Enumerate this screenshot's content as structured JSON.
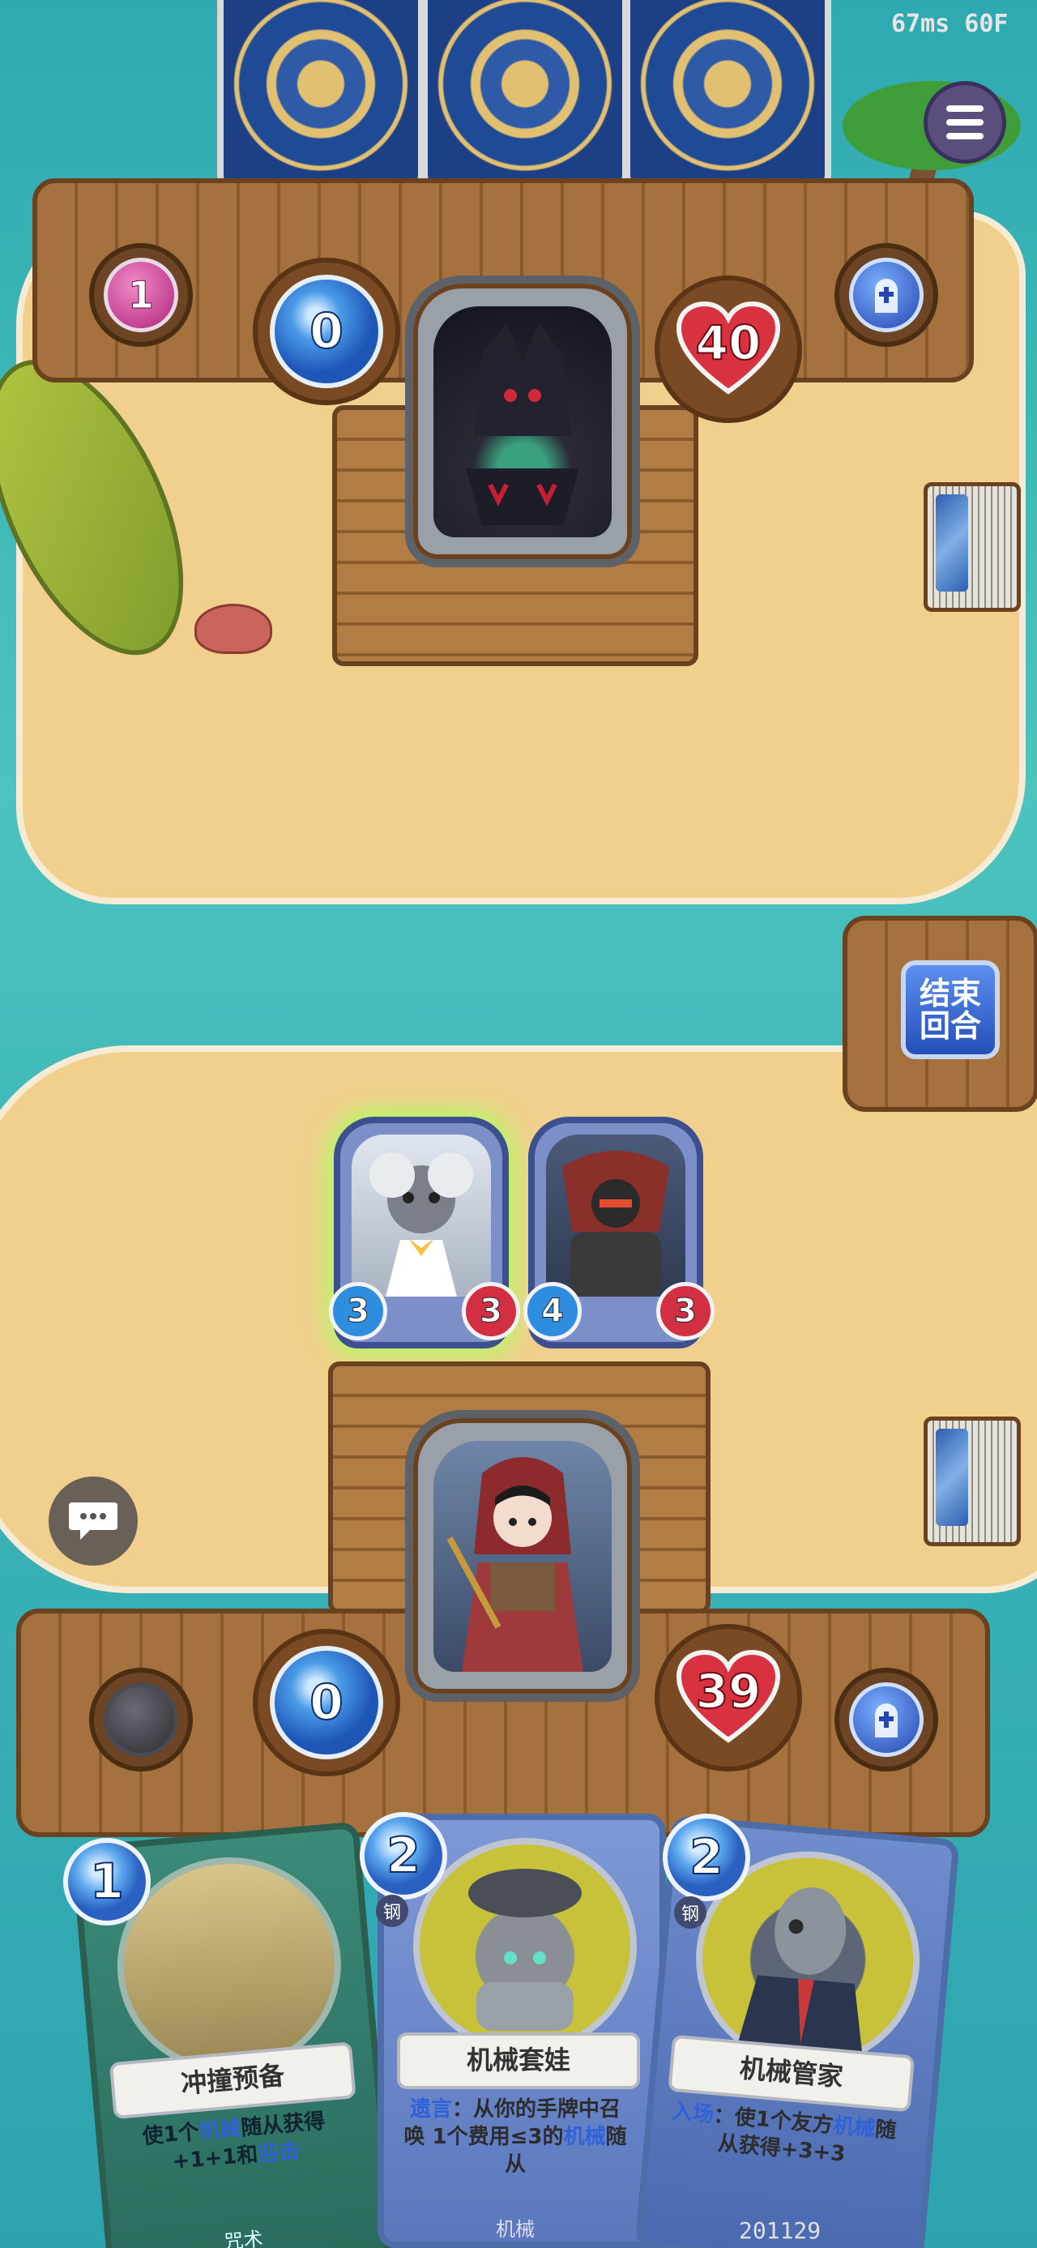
{
  "hud": {
    "perf": "67ms 60F",
    "uid": "201129"
  },
  "opponent": {
    "crystal": "1",
    "mana": "0",
    "health": "40"
  },
  "player": {
    "mana": "0",
    "health": "39"
  },
  "board": {
    "player_minions": [
      {
        "attack": "3",
        "health": "3",
        "playable": true
      },
      {
        "attack": "4",
        "health": "3",
        "playable": false
      }
    ]
  },
  "buttons": {
    "end_turn": "结束回合"
  },
  "hand": [
    {
      "cost": "1",
      "name": "冲撞预备",
      "desc_pre": "使1个",
      "desc_kw": "机械",
      "desc_mid": "随从获得 +1+1和",
      "desc_kw2": "迎击",
      "type": "咒术"
    },
    {
      "cost": "2",
      "tag": "钢",
      "name": "机械套娃",
      "desc_kw": "遗言",
      "desc_mid": "：从你的手牌中召唤 1个费用≤3的",
      "desc_kw2": "机械",
      "desc_post": "随从",
      "type": "机械"
    },
    {
      "cost": "2",
      "tag": "钢",
      "name": "机械管家",
      "desc_kw": "入场",
      "desc_mid": "：使1个友方",
      "desc_kw2": "机械",
      "desc_post": "随从获得+3+3"
    }
  ],
  "colors": {
    "sea": "#3fb7b4",
    "sand": "#f0d08c",
    "wood": "#a5713e",
    "mana": "#2a60c0",
    "health": "#d23042"
  },
  "icons": [
    "menu-icon",
    "tombstone-icon",
    "chat-icon",
    "heart-icon"
  ]
}
